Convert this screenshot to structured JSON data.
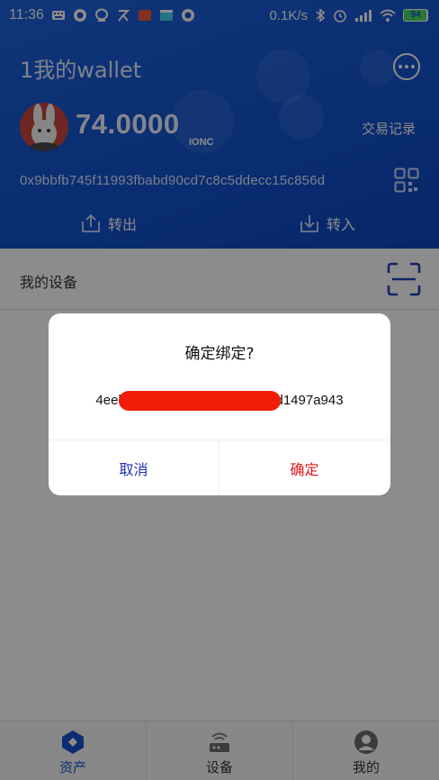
{
  "status_bar": {
    "time": "11:36",
    "net_speed": "0.1K/s",
    "battery": "94"
  },
  "wallet": {
    "title": "1我的wallet",
    "balance": "74.0000",
    "coin": "IONC",
    "records_link": "交易记录",
    "address": "0x9bbfb745f11993fbabd90cd7c8c5ddecc15c856d",
    "send_label": "转出",
    "receive_label": "转入"
  },
  "devices": {
    "label": "我的设备"
  },
  "tabbar": {
    "tabs": [
      {
        "label": "资产",
        "active": true
      },
      {
        "label": "设备",
        "active": false
      },
      {
        "label": "我的",
        "active": false
      }
    ]
  },
  "dialog": {
    "title": "确定绑定?",
    "message": "4eeb                                        d1497a943",
    "cancel_label": "取消",
    "confirm_label": "确定"
  },
  "colors": {
    "accent": "#1453cf",
    "cancel": "#1f2fb8",
    "confirm": "#e0151a"
  },
  "icons": [
    "keyboard-icon",
    "circle-icon",
    "alien-icon",
    "tiktok-icon",
    "rss-icon",
    "clapper-icon",
    "circle-icon",
    "bluetooth-icon",
    "alarm-icon",
    "signal-icon",
    "wifi-icon",
    "battery-icon",
    "more-icon",
    "avatar-rabbit",
    "qr-icon",
    "share-out-icon",
    "download-in-icon",
    "scan-icon",
    "wallet-tab-icon",
    "device-tab-icon",
    "profile-tab-icon"
  ]
}
